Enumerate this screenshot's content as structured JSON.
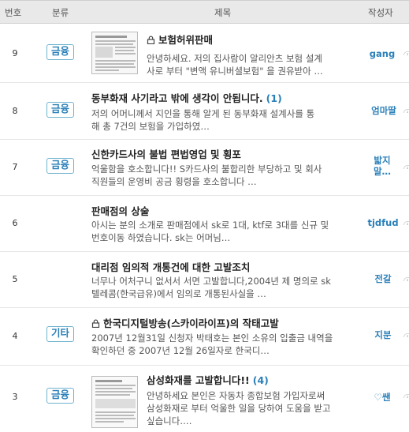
{
  "header": {
    "number": "번호",
    "category": "분류",
    "title": "제목",
    "author": "작성자"
  },
  "rows": [
    {
      "number": "9",
      "category": "금융",
      "title": "보험허위판매",
      "locked": true,
      "comments": "",
      "excerpt_line1": "안녕하세요. 저의 집사람이 알리안츠 보험 설계",
      "excerpt_line2": "사로 부터 \"변액 유니버셜보험\" 을 권유받아 …",
      "excerpt_line3": "",
      "author": "gang",
      "author2": "",
      "has_thumb": true
    },
    {
      "number": "8",
      "category": "금융",
      "title": "동부화재 사기라고 밖에 생각이 안됩니다.",
      "locked": false,
      "comments": "(1)",
      "excerpt_line1": "  저의 어머니께서 지인을 통해 알게 된 동부화재 설계사를 통",
      "excerpt_line2": "해 총 7건의 보험을 가입하였…",
      "excerpt_line3": "",
      "author": "엄마딸",
      "author2": "",
      "has_thumb": false
    },
    {
      "number": "7",
      "category": "금융",
      "title": "신한카드사의 불법 편법영업 및 횡포",
      "locked": false,
      "comments": "",
      "excerpt_line1": "억울함을 호소합니다!! S카드사의  불합리한 부당하고 및 회사",
      "excerpt_line2": "직원들의 운영비 공금 횡령을 호소합니다 …",
      "excerpt_line3": "",
      "author": "밟지",
      "author2": "말…",
      "has_thumb": false
    },
    {
      "number": "6",
      "category": "",
      "title": "판매점의 상술",
      "locked": false,
      "comments": "",
      "excerpt_line1": "아시는 분의 소개로 판매점에서 sk로 1대, ktf로 3대를  신규 및",
      "excerpt_line2": "번호이동 하였습니다. sk는 어머님…",
      "excerpt_line3": "",
      "author": "tjdfud",
      "author2": "",
      "has_thumb": false
    },
    {
      "number": "5",
      "category": "",
      "title": "대리점 임의적 개통건에 대한 고발조치",
      "locked": false,
      "comments": "",
      "excerpt_line1": "너무나 어처구니 없서서 서면 고발합니다,2004년 제 명의로 sk",
      "excerpt_line2": "텔레콤(한국급유)에서 임의로 개통된사실을 …",
      "excerpt_line3": "",
      "author": "전갈",
      "author2": "",
      "has_thumb": false
    },
    {
      "number": "4",
      "category": "기타",
      "title": "한국디지털방송(스카이라이프)의 작태고발",
      "locked": true,
      "comments": "",
      "excerpt_line1": "2007년 12월31일 신청자 박태호는 본인 소유의 입출금 내역을",
      "excerpt_line2": "확인하던 중 2007년 12월 26일자로 한국디…",
      "excerpt_line3": "",
      "author": "지분",
      "author2": "",
      "has_thumb": false
    },
    {
      "number": "3",
      "category": "금융",
      "title": "삼성화재를 고발합니다!!",
      "locked": false,
      "comments": "(4)",
      "excerpt_line1": "안녕하세요 본인은 자동차 종합보험 가입자로써",
      "excerpt_line2": "삼성화재로 부터 억울한 일을 당하여 도움을 받고",
      "excerpt_line3": "싶습니다.…",
      "author": "♡쌘",
      "author2": "",
      "has_thumb": true
    }
  ]
}
